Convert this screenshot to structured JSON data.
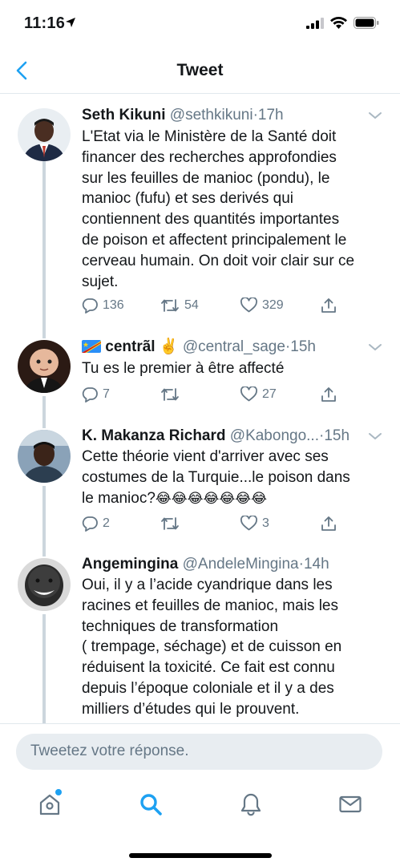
{
  "status_bar": {
    "time": "11:16"
  },
  "header": {
    "title": "Tweet"
  },
  "tweets": [
    {
      "name": "Seth Kikuni",
      "handle": "@sethkikuni",
      "separator": "·",
      "time": "17h",
      "text_lines": [
        "L'Etat via le Ministère de la Santé doit",
        "financer des recherches approfondies",
        "sur les feuilles de manioc (pondu), le",
        "manioc (fufu) et ses derivés qui",
        "contiennent des quantités importantes",
        "de poison et affectent principalement le",
        "cerveau humain. On doit voir clair sur ce",
        "sujet."
      ],
      "replies": "136",
      "retweets": "54",
      "likes": "329"
    },
    {
      "flag": "DR Congo flag",
      "name": "centrãl",
      "name_emoji": "✌️",
      "handle": "@central_sage",
      "separator": "·",
      "time": "15h",
      "text_lines": [
        "Tu es le premier à être affecté"
      ],
      "replies": "7",
      "retweets": "",
      "likes": "27"
    },
    {
      "name": "K. Makanza Richard",
      "handle": "@Kabongo...",
      "separator": "·",
      "time": "15h",
      "text_lines": [
        "Cette théorie vient d'arriver avec ses",
        "costumes de la Turquie...le poison dans",
        "le manioc?"
      ],
      "emoji_trail": "😂😂😂😂😂😂😂",
      "replies": "2",
      "retweets": "",
      "likes": "3"
    },
    {
      "name": "Angemingina",
      "handle": "@AndeleMingina",
      "separator": "·",
      "time": "14h",
      "text_lines": [
        "Oui, il y a l’acide cyandrique dans les",
        "racines et feuilles de manioc, mais les",
        "techniques de transformation",
        "( trempage, séchage) et de cuisson en",
        "réduisent la toxicité. Ce fait est connu",
        "depuis l’époque coloniale et il y a des",
        "milliers d’études qui le prouvent."
      ]
    }
  ],
  "reply": {
    "placeholder": "Tweetez votre réponse."
  },
  "tabs": [
    {
      "icon": "home-icon",
      "label": "Home"
    },
    {
      "icon": "search-icon",
      "label": "Search"
    },
    {
      "icon": "bell-icon",
      "label": "Notifications"
    },
    {
      "icon": "mail-icon",
      "label": "Messages"
    }
  ],
  "colors": {
    "accent": "#1da1f2",
    "secondary_text": "#657786",
    "divider": "#e1e8ed"
  }
}
